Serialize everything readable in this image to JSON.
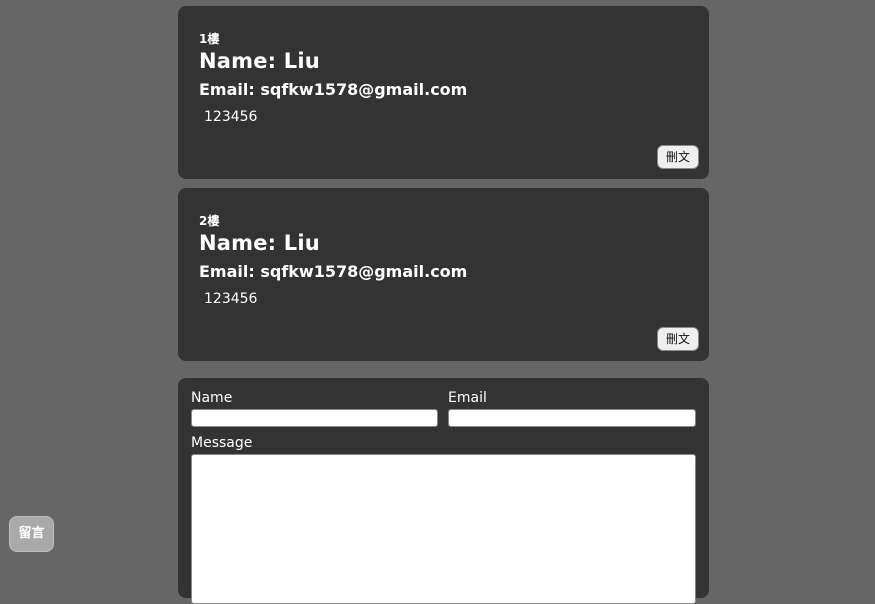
{
  "posts": [
    {
      "floor": "1樓",
      "name": "Name: Liu",
      "email": "Email: sqfkw1578@gmail.com",
      "message": "123456",
      "delete_label": "刪文"
    },
    {
      "floor": "2樓",
      "name": "Name: Liu",
      "email": "Email: sqfkw1578@gmail.com",
      "message": "123456",
      "delete_label": "刪文"
    }
  ],
  "form": {
    "name_label": "Name",
    "email_label": "Email",
    "message_label": "Message",
    "name_value": "",
    "email_value": "",
    "message_value": ""
  },
  "floating_button": {
    "label": "留言"
  }
}
